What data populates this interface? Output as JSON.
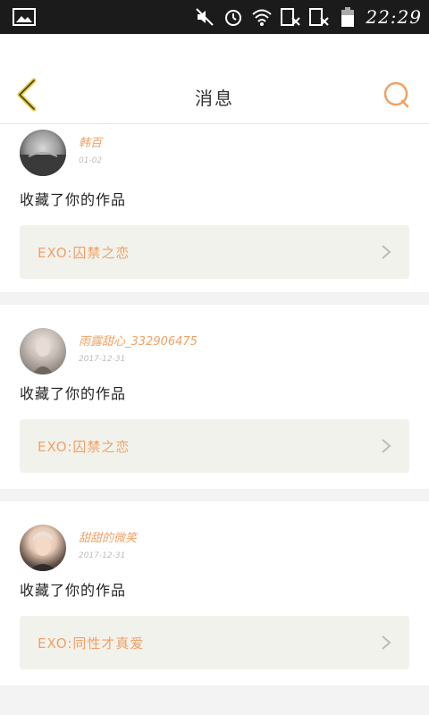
{
  "statusbar": {
    "time": "22:29"
  },
  "header": {
    "title": "消息"
  },
  "colors": {
    "accent": "#f0a167",
    "back_arrow": "#e7c637"
  },
  "messages": [
    {
      "username": "韩百",
      "date": "01-02",
      "action": "收藏了你的作品",
      "work": "EXO:囚禁之恋"
    },
    {
      "username": "雨露甜心_332906475",
      "date": "2017-12-31",
      "action": "收藏了你的作品",
      "work": "EXO:囚禁之恋"
    },
    {
      "username": "甜甜的微笑",
      "date": "2017-12-31",
      "action": "收藏了你的作品",
      "work": "EXO:同性才真爱"
    }
  ]
}
